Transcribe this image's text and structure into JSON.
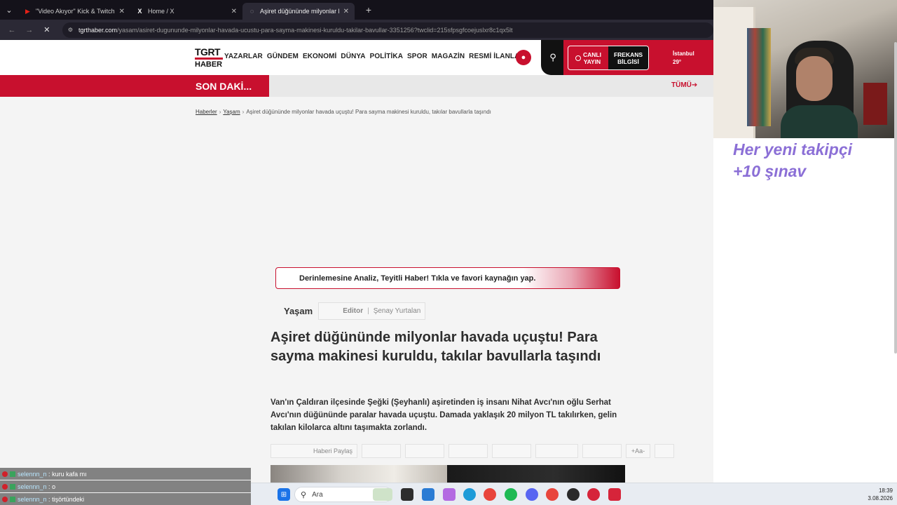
{
  "browser": {
    "tabs": [
      {
        "title": "\"Video Akıyor\" Kick & Twitch K",
        "icon": "youtube-icon",
        "icon_color": "#e62117",
        "active": false
      },
      {
        "title": "Home / X",
        "icon": "x-icon",
        "icon_color": "#ffffff",
        "active": false
      },
      {
        "title": "Aşiret düğününde milyonlar ha",
        "icon": "site-icon",
        "icon_color": "#c8102e",
        "active": true
      }
    ],
    "new_tab_label": "+",
    "url_host": "tgrthaber.com",
    "url_path": "/yasam/asiret-dugununde-milyonlar-havada-ucustu-para-sayma-makinesi-kuruldu-takilar-bavullar-3351256?twclid=215sfpsgfcoejuslxr8c1qx5lt"
  },
  "site": {
    "logo_top": "TGRT",
    "logo_bottom": "HABER",
    "nav": [
      "YAZARLAR",
      "GÜNDEM",
      "EKONOMİ",
      "DÜNYA",
      "POLİTİKA",
      "SPOR",
      "MAGAZİN",
      "RESMİ İLANLAI"
    ],
    "live_label_1": "CANLI",
    "live_label_2": "YAYIN",
    "freq_label_1": "FREKANS",
    "freq_label_2": "BİLGİSİ",
    "city": "İstanbul",
    "temperature": "29°",
    "breaking_label": "SON DAKİ...",
    "all_label": "TÜMÜ➔",
    "brand_color": "#c8102e"
  },
  "breadcrumb": {
    "home": "Haberler",
    "section": "Yaşam",
    "current": "Aşiret düğününde milyonlar havada uçuştu! Para sayma makinesi kuruldu, takılar bavullarla taşındı"
  },
  "promo_text": "Derinlemesine Analiz, Teyitli Haber! Tıkla ve favori kaynağın yap.",
  "article": {
    "category": "Yaşam",
    "editor_label": "Editor",
    "editor_sep": "|",
    "editor_name": "Şenay Yurtalan",
    "headline": "Aşiret düğününde milyonlar havada uçuştu! Para sayma makinesi kuruldu, takılar bavullarla taşındı",
    "lead": "Van'ın Çaldıran ilçesinde Şeğki (Şeyhanlı) aşiretinden iş insanı Nihat Avcı'nın oğlu Serhat Avcı'nın düğününde paralar havada uçuştu. Damada yaklaşık 20 milyon TL takılırken, gelin takılan kilolarca altını taşımakta zorlandı.",
    "share_label": "Haberi Paylaş",
    "font_size_label": "+Aa-"
  },
  "overlay": {
    "line1": "Her yeni takipçi",
    "line2": "+10 şınav",
    "text_color": "#8b6fd6"
  },
  "chat": [
    {
      "user": "selennn_n",
      "message": "kuru kafa mı"
    },
    {
      "user": "selennn_n",
      "message": "o"
    },
    {
      "user": "selennn_n",
      "message": "tişörtündeki"
    }
  ],
  "taskbar": {
    "search_placeholder": "Ara",
    "time": "18:39",
    "date": "3.08.2026"
  }
}
